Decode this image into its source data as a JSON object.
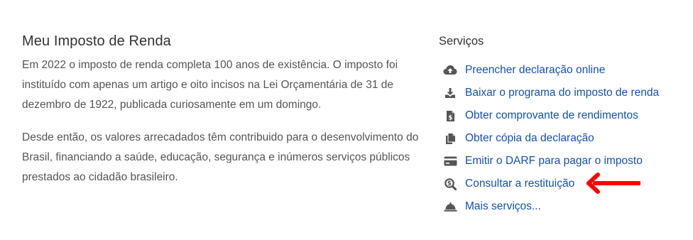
{
  "heading": "Meu Imposto de Renda",
  "paragraphs": [
    "Em 2022 o imposto de renda completa 100 anos de existência. O imposto foi instituído com apenas um artigo e oito incisos na Lei Orçamentária de 31 de dezembro de 1922, publicada curiosamente em um domingo.",
    "Desde então, os valores arrecadados têm contribuido para o desenvolvimento do Brasil, financiando a saúde, educação, segurança e inúmeros serviços públicos prestados ao cidadão brasileiro."
  ],
  "services": {
    "title": "Serviços",
    "items": [
      {
        "label": "Preencher declaração online",
        "icon": "cloud-upload-icon"
      },
      {
        "label": "Baixar o programa do imposto de renda",
        "icon": "download-icon"
      },
      {
        "label": "Obter comprovante de rendimentos",
        "icon": "receipt-icon"
      },
      {
        "label": "Obter cópia da declaração",
        "icon": "copy-icon"
      },
      {
        "label": "Emitir o DARF para pagar o imposto",
        "icon": "credit-card-icon"
      },
      {
        "label": "Consultar a restituição",
        "icon": "search-dollar-icon"
      },
      {
        "label": "Mais serviços...",
        "icon": "service-bell-icon"
      }
    ]
  },
  "colors": {
    "link": "#1351b4",
    "icon": "#555555",
    "arrow": "#ff0000",
    "text": "#555555",
    "heading": "#333333"
  }
}
